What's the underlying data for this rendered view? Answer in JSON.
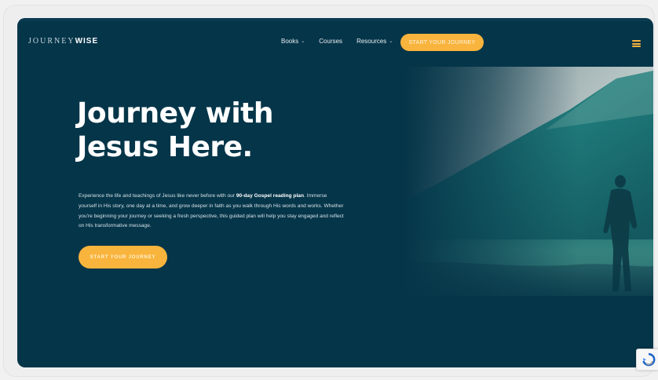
{
  "nav": {
    "logo_light": "JOURNEY",
    "logo_bold": "WISE",
    "items": [
      {
        "label": "Books",
        "dropdown": true
      },
      {
        "label": "Courses",
        "dropdown": false
      },
      {
        "label": "Resources",
        "dropdown": true
      }
    ],
    "cta_label": "START YOUR JOURNEY",
    "menu_icon": "hamburger-menu-icon"
  },
  "hero": {
    "title_line1": "Journey with",
    "title_line2": "Jesus Here.",
    "desc_part1": "Experience the life and teachings of Jesus like never before with our ",
    "desc_bold": "90-day Gospel reading plan",
    "desc_part2": ". Immerse yourself in His story, one day at a time, and grow deeper in faith as you walk through His words and works. Whether you're beginning your journey or seeking a fresh perspective, this guided plan will help you stay engaged and reflect on His transformative message.",
    "cta_label": "START YOUR JOURNEY",
    "image": "person-walking-by-sea-mountain-image"
  },
  "widgets": {
    "recaptcha_icon": "recaptcha-badge-icon"
  },
  "colors": {
    "background": "#053549",
    "accent": "#f9b43d",
    "text": "#ffffff"
  }
}
